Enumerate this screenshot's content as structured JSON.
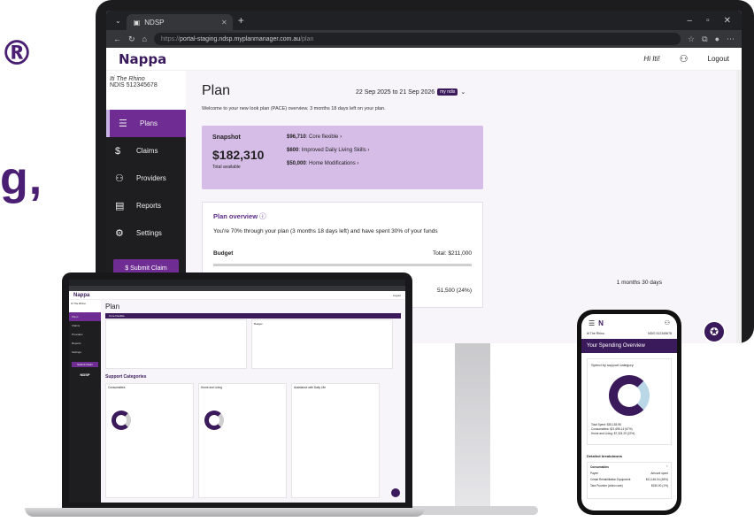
{
  "marketing": {
    "reg_mark": "®",
    "partial_text": "g,"
  },
  "browser": {
    "tab_title": "NDSP",
    "url_prefix": "https://",
    "url_main": "portal-staging.ndsp.myplanmanager.com.au",
    "url_path": "/plan"
  },
  "header": {
    "logo": "Nappa",
    "greeting": "Hi Iti!",
    "logout": "Logout"
  },
  "sidebar": {
    "user_name": "Iti The Rhino",
    "ndis_number": "NDIS 512345678",
    "items": [
      {
        "label": "Plans"
      },
      {
        "label": "Claims"
      },
      {
        "label": "Providers"
      },
      {
        "label": "Reports"
      },
      {
        "label": "Settings"
      }
    ],
    "submit_claim": "Submit Claim"
  },
  "plan": {
    "title": "Plan",
    "dates": "22 Sep 2025 to 21 Sep 2026",
    "ndis_badge": "my ndis",
    "intro": "Welcome to your new look plan (PACE) overview. 3 months 18 days left on your plan."
  },
  "snapshot": {
    "title": "Snapshot",
    "total": "$182,310",
    "total_label": "Total available",
    "lines": [
      {
        "amount": "$96,710",
        "label": ": Core flexible"
      },
      {
        "amount": "$600",
        "label": ": Improved Daily Living Skills"
      },
      {
        "amount": "$50,000",
        "label": ": Home Modifications"
      }
    ]
  },
  "overview": {
    "title": "Plan overview",
    "text": "You're 70% through your plan (3 months 18 days left) and have spent 30% of your funds",
    "budget_label": "Budget",
    "budget_total": "Total: $211,000",
    "spent_partial": "51,500 (24%)",
    "time_partial": "1 months 30 days"
  },
  "laptop": {
    "plan_title": "Plan",
    "section": "Core Flexible",
    "support_categories": "Support Categories",
    "cards": [
      "Consumables",
      "Home and Living",
      "Assistance with Daily Life"
    ],
    "budget_label": "Budget",
    "logo": "NDSP"
  },
  "phone": {
    "user_name": "Iti The Rhino",
    "ndis_number": "NDIS 512345678",
    "title": "Your Spending Overview",
    "chart_title": "Spend by support category",
    "total_spent": "Total Spent: $35,183.98",
    "stat1": "Consumables: $21,696.14 (67%)",
    "stat2": "Home and Living: $7,324.29 (22%)",
    "detailed": "Detailed breakdowns",
    "table_title": "Consumables",
    "table_col1": "Payee",
    "table_col2": "Amount spent",
    "rows": [
      {
        "payee": "Cristal Rehabilitation Equipment",
        "amount": "$11,146.04 (48%)"
      },
      {
        "payee": "Tara Provider (video care)",
        "amount": "$150.00 (1%)"
      }
    ]
  },
  "colors": {
    "brand_purple": "#3a1a5b",
    "accent_purple": "#6f2d93",
    "snapshot_bg": "#d6bde7"
  }
}
